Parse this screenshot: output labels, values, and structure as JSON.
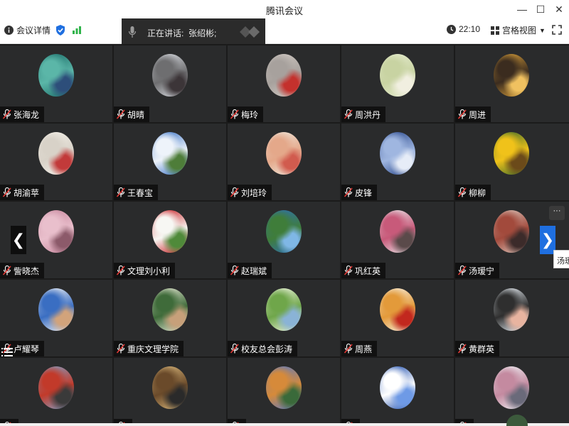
{
  "window": {
    "title": "腾讯会议"
  },
  "toolbar": {
    "meeting_info": "会议详情",
    "time": "22:10",
    "view_mode": "宫格视图"
  },
  "speaking": {
    "label": "正在讲话:",
    "name": "张绍彬;"
  },
  "participants": [
    {
      "name": "张海龙",
      "avatar": "road-photo",
      "colors": [
        "#1d6e6a",
        "#5bb6a8",
        "#2d4e7a"
      ]
    },
    {
      "name": "胡晴",
      "avatar": "mountain-photo",
      "colors": [
        "#d9dce2",
        "#6e6e70",
        "#3c3538"
      ]
    },
    {
      "name": "梅玲",
      "avatar": "toy-car-photo",
      "colors": [
        "#cfc8c2",
        "#a7a19d",
        "#c4312d"
      ]
    },
    {
      "name": "周洪丹",
      "avatar": "flower-photo",
      "colors": [
        "#e6ecd0",
        "#c8d3a2",
        "#f1efe0"
      ]
    },
    {
      "name": "周进",
      "avatar": "clock-art",
      "colors": [
        "#d9a03a",
        "#3b2c1f",
        "#f0c160"
      ]
    },
    {
      "name": "胡渝苹",
      "avatar": "doodle-art",
      "colors": [
        "#f3efe8",
        "#d8d2c8",
        "#c23a3a"
      ]
    },
    {
      "name": "王春宝",
      "avatar": "sky-photo",
      "colors": [
        "#3a73c6",
        "#eef3fa",
        "#4e7d39"
      ]
    },
    {
      "name": "刘培玲",
      "avatar": "baby-photo",
      "colors": [
        "#efe6da",
        "#e4a88a",
        "#d15b4e"
      ]
    },
    {
      "name": "皮锋",
      "avatar": "clouds-photo",
      "colors": [
        "#2c4a8c",
        "#9fb6e0",
        "#e6ecf7"
      ]
    },
    {
      "name": "柳柳",
      "avatar": "sunflower-photo",
      "colors": [
        "#3e6b2a",
        "#f0c21a",
        "#6b4a1a"
      ]
    },
    {
      "name": "訾晓杰",
      "avatar": "blossom-photo",
      "colors": [
        "#c98aa0",
        "#e9bfcc",
        "#8c5a6a"
      ]
    },
    {
      "name": "文理刘小利",
      "avatar": "cherries-photo",
      "colors": [
        "#c81e24",
        "#f7f7f3",
        "#4f8a3a"
      ]
    },
    {
      "name": "赵瑞斌",
      "avatar": "heart-tree-photo",
      "colors": [
        "#2f6fb0",
        "#3f7d3a",
        "#7fb7e6"
      ]
    },
    {
      "name": "巩红英",
      "avatar": "woman-photo",
      "colors": [
        "#e6e3e6",
        "#c85a7a",
        "#5a4a4a"
      ]
    },
    {
      "name": "汤瑷宁",
      "avatar": "girl-art",
      "colors": [
        "#d9c2b8",
        "#a24a3c",
        "#3c2b2a"
      ]
    },
    {
      "name": "卢耀琴",
      "avatar": "couple-cartoon",
      "colors": [
        "#f3f3f3",
        "#3a6ec2",
        "#d2a37b"
      ]
    },
    {
      "name": "重庆文理学院",
      "avatar": "kids-collage",
      "colors": [
        "#e6e8d4",
        "#3f6b3a",
        "#c7a07a"
      ]
    },
    {
      "name": "校友总会彭涛",
      "avatar": "tree-art",
      "colors": [
        "#eef4df",
        "#6fa64a",
        "#8ab3d6"
      ]
    },
    {
      "name": "周燕",
      "avatar": "tiger-cartoon",
      "colors": [
        "#f6efe0",
        "#e39a3a",
        "#c2281e"
      ]
    },
    {
      "name": "黄群英",
      "avatar": "glasses-cartoon",
      "colors": [
        "#eaf1f7",
        "#2f2f2f",
        "#e8b4a0"
      ]
    },
    {
      "name": "",
      "avatar": "tabletennis-photo",
      "colors": [
        "#7fa0c6",
        "#c23a2a",
        "#3a3a3a"
      ]
    },
    {
      "name": "",
      "avatar": "couple-photo",
      "colors": [
        "#d8b67a",
        "#6a4a2a",
        "#2a2a2a"
      ]
    },
    {
      "name": "",
      "avatar": "flowers-painting",
      "colors": [
        "#5a7ac2",
        "#d68a3a",
        "#3a6a3a"
      ]
    },
    {
      "name": "",
      "avatar": "blue-dots-art",
      "colors": [
        "#1e4fb0",
        "#ffffff",
        "#6e9ae6"
      ]
    },
    {
      "name": "",
      "avatar": "anime-girl-art",
      "colors": [
        "#eef0f4",
        "#c48aa0",
        "#6a6a7a"
      ]
    }
  ]
}
